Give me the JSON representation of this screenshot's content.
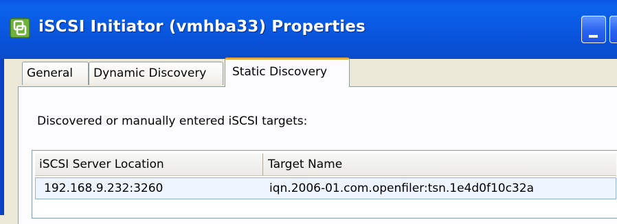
{
  "window": {
    "title": "iSCSI Initiator (vmhba33) Properties"
  },
  "tabs": [
    {
      "label": "General",
      "active": false
    },
    {
      "label": "Dynamic Discovery",
      "active": false
    },
    {
      "label": "Static Discovery",
      "active": true
    }
  ],
  "static_discovery": {
    "caption": "Discovered or manually entered iSCSI targets:",
    "columns": [
      "iSCSI Server Location",
      "Target Name"
    ],
    "rows": [
      [
        "192.168.9.232:3260",
        "iqn.2006-01.com.openfiler:tsn.1e4d0f10c32a"
      ]
    ]
  },
  "icons": {
    "app": "vmware-logo-icon",
    "minimize": "minimize-icon"
  },
  "colors": {
    "titlebar": "#0a5be4",
    "active_tab_accent": "#e9a83a",
    "selected_row": "#eef4fd"
  }
}
